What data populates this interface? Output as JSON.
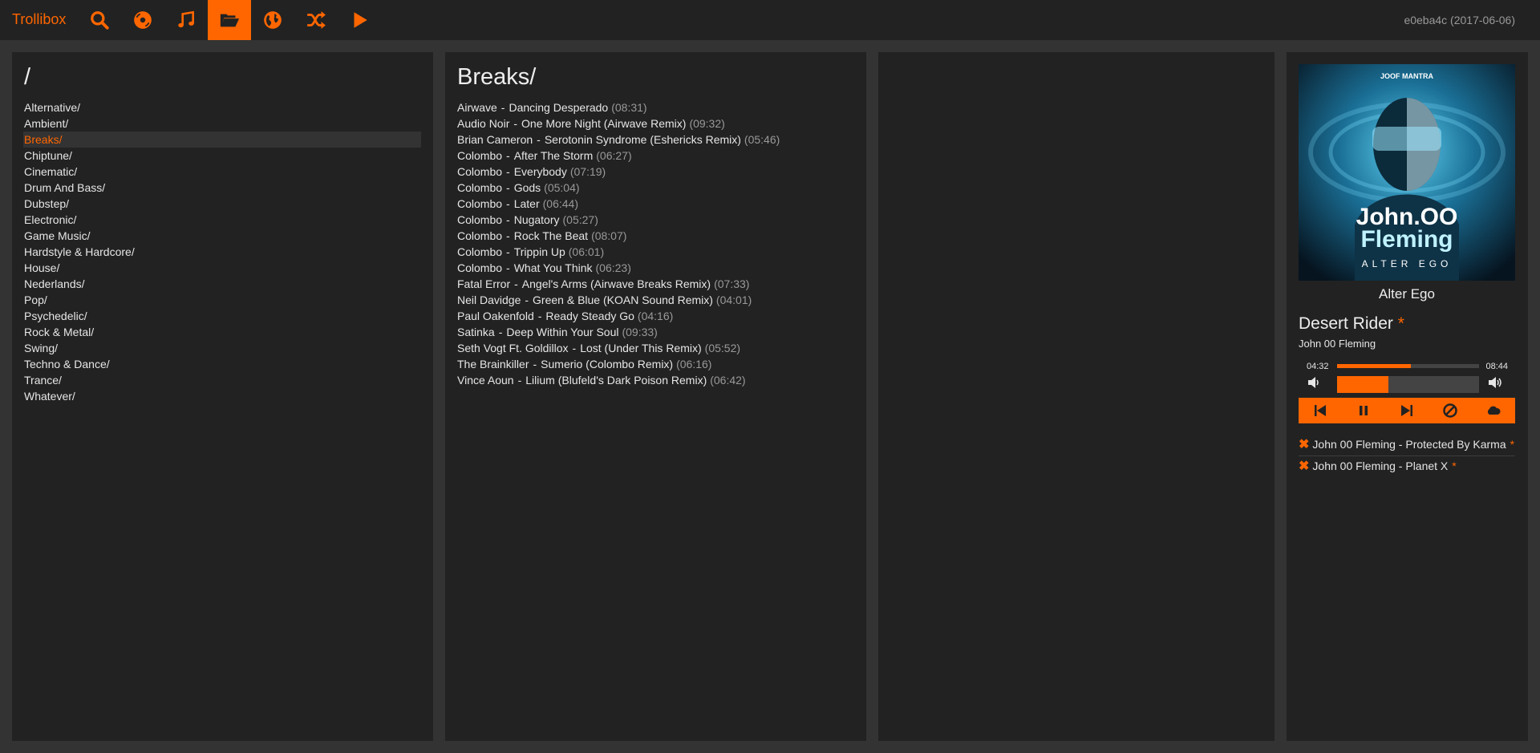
{
  "app": {
    "brand": "Trollibox",
    "version": "e0eba4c (2017-06-06)"
  },
  "nav": [
    {
      "icon": "search-icon",
      "label": "Search"
    },
    {
      "icon": "albums-icon",
      "label": "Albums"
    },
    {
      "icon": "music-note-icon",
      "label": "Genres"
    },
    {
      "icon": "folder-open-icon",
      "label": "Files",
      "active": true
    },
    {
      "icon": "globe-icon",
      "label": "Streams"
    },
    {
      "icon": "shuffle-icon",
      "label": "Shuffle"
    },
    {
      "icon": "play-icon",
      "label": "Play"
    }
  ],
  "browser": {
    "root_title": "/",
    "folders": [
      "Alternative/",
      "Ambient/",
      "Breaks/",
      "Chiptune/",
      "Cinematic/",
      "Drum And Bass/",
      "Dubstep/",
      "Electronic/",
      "Game Music/",
      "Hardstyle & Hardcore/",
      "House/",
      "Nederlands/",
      "Pop/",
      "Psychedelic/",
      "Rock & Metal/",
      "Swing/",
      "Techno & Dance/",
      "Trance/",
      "Whatever/"
    ],
    "selected_index": 2,
    "folder_title": "Breaks/",
    "tracks": [
      {
        "artist": "Airwave",
        "title": "Dancing Desperado",
        "duration": "(08:31)"
      },
      {
        "artist": "Audio Noir",
        "title": "One More Night (Airwave Remix)",
        "duration": "(09:32)"
      },
      {
        "artist": "Brian Cameron",
        "title": "Serotonin Syndrome (Eshericks Remix)",
        "duration": "(05:46)"
      },
      {
        "artist": "Colombo",
        "title": "After The Storm",
        "duration": "(06:27)"
      },
      {
        "artist": "Colombo",
        "title": "Everybody",
        "duration": "(07:19)"
      },
      {
        "artist": "Colombo",
        "title": "Gods",
        "duration": "(05:04)"
      },
      {
        "artist": "Colombo",
        "title": "Later",
        "duration": "(06:44)"
      },
      {
        "artist": "Colombo",
        "title": "Nugatory",
        "duration": "(05:27)"
      },
      {
        "artist": "Colombo",
        "title": "Rock The Beat",
        "duration": "(08:07)"
      },
      {
        "artist": "Colombo",
        "title": "Trippin Up",
        "duration": "(06:01)"
      },
      {
        "artist": "Colombo",
        "title": "What You Think",
        "duration": "(06:23)"
      },
      {
        "artist": "Fatal Error",
        "title": "Angel's Arms (Airwave Breaks Remix)",
        "duration": "(07:33)"
      },
      {
        "artist": "Neil Davidge",
        "title": "Green & Blue (KOAN Sound Remix)",
        "duration": "(04:01)"
      },
      {
        "artist": "Paul Oakenfold",
        "title": "Ready Steady Go",
        "duration": "(04:16)"
      },
      {
        "artist": "Satinka",
        "title": "Deep Within Your Soul",
        "duration": "(09:33)"
      },
      {
        "artist": "Seth Vogt Ft. Goldillox",
        "title": "Lost (Under This Remix)",
        "duration": "(05:52)"
      },
      {
        "artist": "The Brainkiller",
        "title": "Sumerio (Colombo Remix)",
        "duration": "(06:16)"
      },
      {
        "artist": "Vince Aoun",
        "title": "Lilium (Blufeld's Dark Poison Remix)",
        "duration": "(06:42)"
      }
    ]
  },
  "player": {
    "cover": {
      "label": "JOOF MANTRA",
      "artist_line1": "John.OO",
      "artist_line2": "Fleming",
      "album_line": "ALTER EGO"
    },
    "album": "Alter Ego",
    "title": "Desert Rider",
    "star": "*",
    "artist": "John 00 Fleming",
    "time_current": "04:32",
    "time_total": "08:44",
    "progress_fraction": 0.52,
    "volume_fraction": 0.36,
    "controls": [
      "previous-icon",
      "pause-icon",
      "next-icon",
      "stop-icon",
      "cloud-icon"
    ]
  },
  "queue": [
    {
      "text": "John 00 Fleming - Protected By Karma",
      "star": "*"
    },
    {
      "text": "John 00 Fleming - Planet X",
      "star": "*"
    }
  ],
  "colors": {
    "accent": "#ff6600",
    "panel": "#222222",
    "background": "#333333",
    "muted": "#999999"
  }
}
